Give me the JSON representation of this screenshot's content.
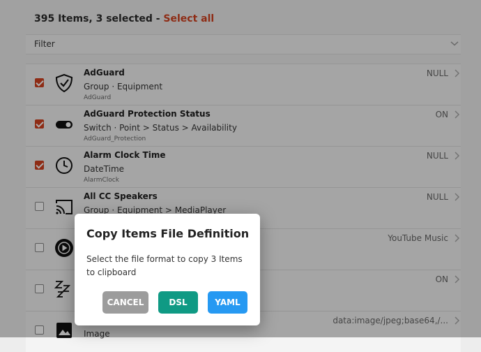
{
  "header": {
    "summary": "395 Items, 3 selected - ",
    "select_all": "Select all"
  },
  "filter": {
    "label": "Filter"
  },
  "items": [
    {
      "title": "AdGuard",
      "sub": "Group · Equipment",
      "name": "AdGuard",
      "state": "NULL",
      "checked": true,
      "icon": "adguard-shield-icon"
    },
    {
      "title": "AdGuard Protection Status",
      "sub": "Switch · Point > Status > Availability",
      "name": "AdGuard_Protection",
      "state": "ON",
      "checked": true,
      "icon": "toggle-switch-icon"
    },
    {
      "title": "Alarm Clock Time",
      "sub": "DateTime",
      "name": "AlarmClock",
      "state": "NULL",
      "checked": true,
      "icon": "clock-icon"
    },
    {
      "title": "All CC Speakers",
      "sub": "Group · Equipment > MediaPlayer",
      "name": "",
      "state": "NULL",
      "checked": false,
      "icon": "cast-icon"
    },
    {
      "title": "",
      "sub": "",
      "name": "",
      "state": "YouTube Music",
      "checked": false,
      "icon": "play-circle-icon"
    },
    {
      "title": "",
      "sub": "",
      "name": "",
      "state": "ON",
      "checked": false,
      "icon": "sleep-zzz-icon"
    },
    {
      "title": "",
      "sub": "Image",
      "name": "",
      "state": "data:image/jpeg;base64,/...",
      "checked": false,
      "icon": "image-icon"
    }
  ],
  "dialog": {
    "title": "Copy Items File Definition",
    "message": "Select the file format to copy 3 Items to clipboard",
    "cancel": "CANCEL",
    "dsl": "DSL",
    "yaml": "YAML"
  },
  "colors": {
    "accent": "#d1411f",
    "dsl": "#0f9a84",
    "yaml": "#2699f2",
    "cancel": "#9c9c9c"
  }
}
